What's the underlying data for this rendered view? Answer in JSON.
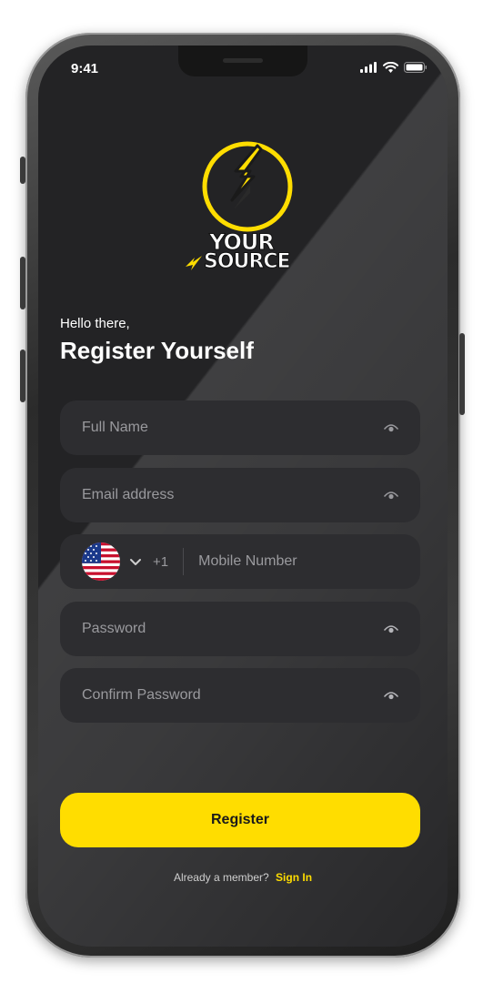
{
  "status_bar": {
    "time": "9:41",
    "icons": [
      "signal-icon",
      "wifi-icon",
      "battery-icon"
    ]
  },
  "brand": {
    "line1": "YOUR",
    "line2": "SOURCE",
    "accent_color": "#FFDD00"
  },
  "header": {
    "greeting": "Hello there,",
    "title": "Register Yourself"
  },
  "form": {
    "full_name_placeholder": "Full Name",
    "email_placeholder": "Email address",
    "phone": {
      "country_flag": "us-flag",
      "dial_code": "+1",
      "placeholder": "Mobile Number"
    },
    "password_placeholder": "Password",
    "confirm_password_placeholder": "Confirm Password"
  },
  "actions": {
    "register_label": "Register"
  },
  "footer": {
    "prompt": "Already a member?",
    "link_label": "Sign In"
  },
  "colors": {
    "background": "#232325",
    "field_bg": "#2D2D30",
    "accent": "#FFDD00"
  }
}
